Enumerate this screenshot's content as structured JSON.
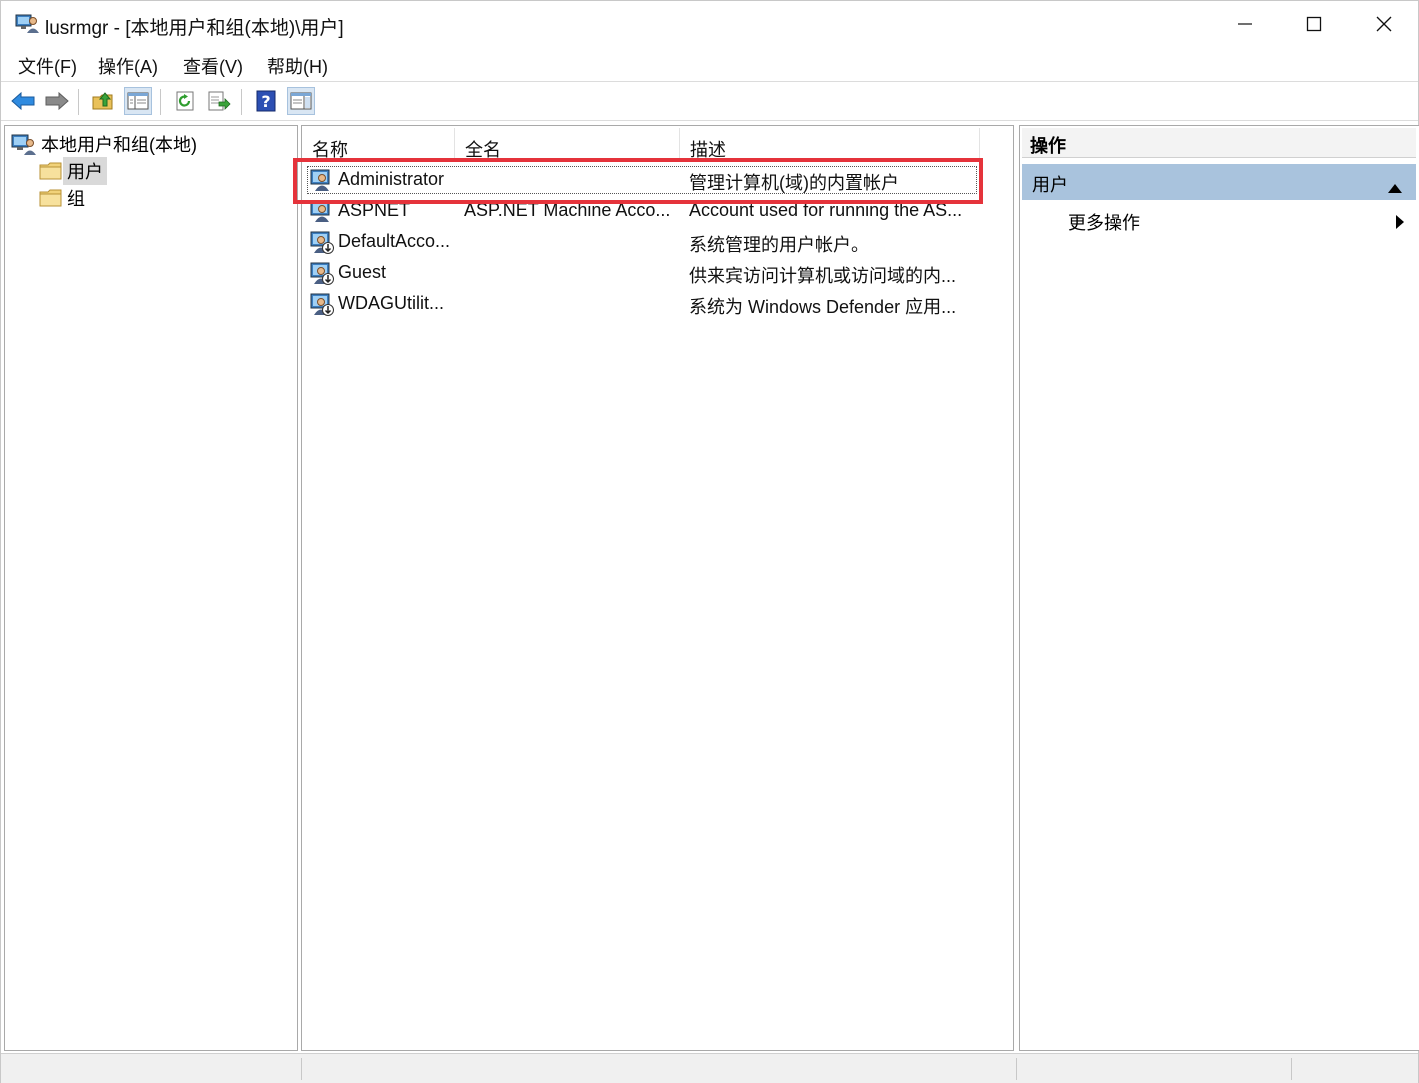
{
  "window": {
    "title": "lusrmgr - [本地用户和组(本地)\\用户]"
  },
  "menu": [
    "文件(F)",
    "操作(A)",
    "查看(V)",
    "帮助(H)"
  ],
  "toolbar": {
    "buttons": [
      "back-icon",
      "forward-icon",
      "up-folder-icon",
      "show-hide-tree-icon",
      "refresh-icon",
      "export-list-icon",
      "help-icon",
      "show-hide-action-pane-icon"
    ]
  },
  "tree": {
    "root": "本地用户和组(本地)",
    "children": [
      "用户",
      "组"
    ],
    "selected": "用户"
  },
  "list": {
    "columns": [
      "名称",
      "全名",
      "描述"
    ],
    "rows": [
      {
        "name": "Administrator",
        "fullname": "",
        "description": "管理计算机(域)的内置帐户"
      },
      {
        "name": "ASPNET",
        "fullname": "ASP.NET Machine Acco...",
        "description": "Account used for running the AS..."
      },
      {
        "name": "DefaultAcco...",
        "fullname": "",
        "description": "系统管理的用户帐户。"
      },
      {
        "name": "Guest",
        "fullname": "",
        "description": "供来宾访问计算机或访问域的内..."
      },
      {
        "name": "WDAGUtilit...",
        "fullname": "",
        "description": "系统为 Windows Defender 应用..."
      }
    ]
  },
  "actions": {
    "header": "操作",
    "section": "用户",
    "items": [
      "更多操作"
    ]
  },
  "colors": {
    "highlight": "#e5333b",
    "section_bg": "#a9c3dd"
  }
}
